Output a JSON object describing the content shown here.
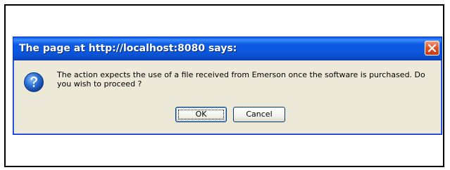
{
  "dialog": {
    "title": "The page at http://localhost:8080 says:",
    "message": "The action expects the use of a file received from Emerson once the software is purchased.  Do you wish to proceed ?",
    "icon": "question-icon",
    "close_icon": "close-icon",
    "ok_label": "OK",
    "cancel_label": "Cancel",
    "colors": {
      "titlebar": "#0b56da",
      "body": "#ece9d8",
      "close": "#e0552a",
      "icon": "#2a6fd6"
    }
  }
}
